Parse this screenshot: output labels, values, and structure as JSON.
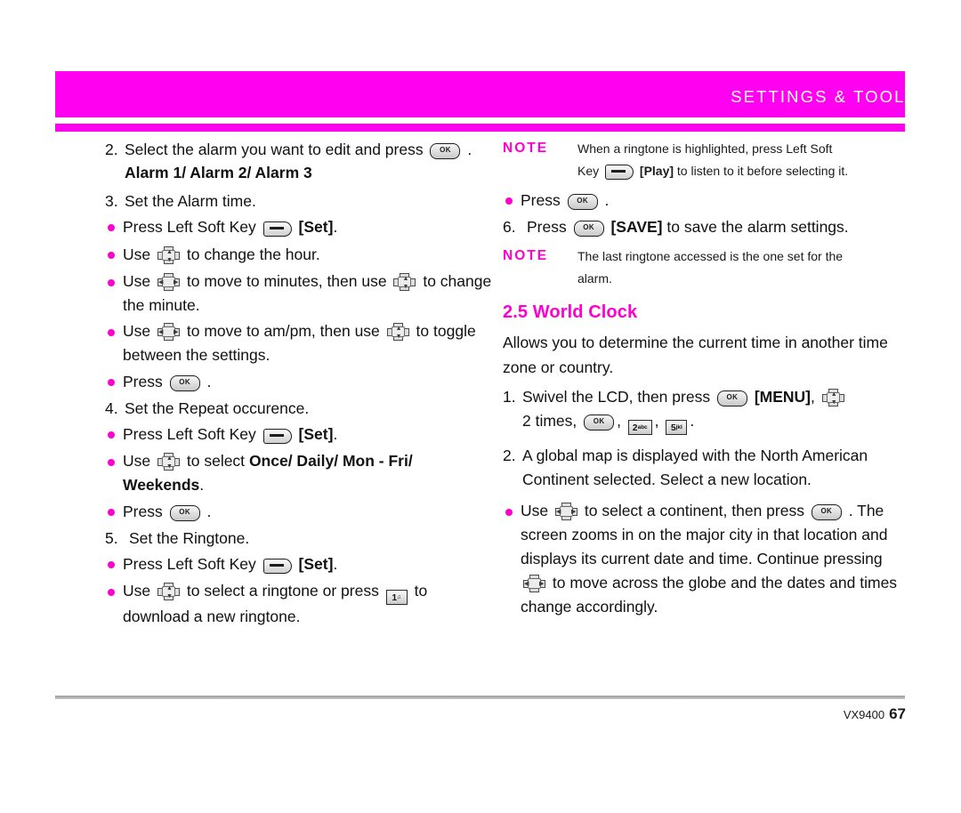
{
  "header": {
    "title": "SETTINGS & TOOLS",
    "band_color": "#ff00f0"
  },
  "icons": {
    "ok": "ok-key-icon",
    "soft": "left-soft-key-icon",
    "nav_vert": "nav-pad-up-down-icon",
    "nav_horz": "nav-pad-left-right-icon",
    "key1": "keypad-1-icon",
    "key2": "keypad-2abc-icon",
    "key5": "keypad-5jkl-icon"
  },
  "left_column": {
    "step2": {
      "num": "2.",
      "text_a": "Select the alarm you want to edit and press",
      "text_b": ".",
      "bold_line": "Alarm 1/ Alarm 2/ Alarm 3"
    },
    "step3": {
      "num": "3.",
      "text": "Set the Alarm time."
    },
    "b1": {
      "a": "Press Left Soft Key",
      "bold": "[Set]",
      "b": "."
    },
    "b2": {
      "a": "Use",
      "b": "to change the hour."
    },
    "b3": {
      "a": "Use",
      "b": "to move to minutes, then use",
      "c": "to change the minute."
    },
    "b4": {
      "a": "Use",
      "b": "to move to am/pm, then use",
      "c": "to toggle between the settings."
    },
    "b5": {
      "a": "Press",
      "b": "."
    },
    "step4": {
      "num": "4.",
      "text": "Set the Repeat occurence."
    },
    "b6": {
      "a": "Press Left Soft Key",
      "bold": "[Set]",
      "b": "."
    },
    "b7": {
      "a": "Use",
      "b": "to select",
      "bold1": "Once/ Daily/ Mon - Fri/",
      "bold2": "Weekends",
      "c": "."
    },
    "b8": {
      "a": "Press",
      "b": "."
    },
    "step5": {
      "num": "5.",
      "text": "Set the Ringtone."
    },
    "b9": {
      "a": "Press Left Soft Key",
      "bold": "[Set]",
      "b": "."
    },
    "b10": {
      "a": "Use",
      "b": "to select a ringtone or press",
      "c": "to download a new ringtone."
    }
  },
  "right_column": {
    "note1": {
      "label": "NOTE",
      "line1": "When a ringtone is highlighted, press Left Soft",
      "line2_a": "Key",
      "line2_bold": "[Play]",
      "line2_b": "to listen to it before selecting it."
    },
    "b1": {
      "a": "Press",
      "b": "."
    },
    "step6": {
      "num": "6.",
      "a": "Press",
      "bold": "[SAVE]",
      "b": "to save the alarm settings."
    },
    "note2": {
      "label": "NOTE",
      "line1": "The last ringtone accessed is the one set for the",
      "line2": "alarm."
    },
    "section": {
      "heading": "2.5 World Clock",
      "intro": "Allows you to determine the current time in another time zone or country."
    },
    "step1": {
      "num": "1.",
      "a": "Swivel the LCD, then press",
      "bold": "[MENU]",
      "comma": ",",
      "b": "2 times,",
      "sep1": ",",
      "sep2": ",",
      "end": "."
    },
    "step2": {
      "num": "2.",
      "text": "A global map is displayed with the North American Continent selected. Select a new location."
    },
    "b2": {
      "a": "Use",
      "b": "to select a continent, then press",
      "c": ". The screen zooms in on the major city in that location and displays its current date and time. Continue pressing",
      "d": "to move across the globe and the dates and times change accordingly."
    }
  },
  "footer": {
    "model": "VX9400",
    "page": "67"
  }
}
